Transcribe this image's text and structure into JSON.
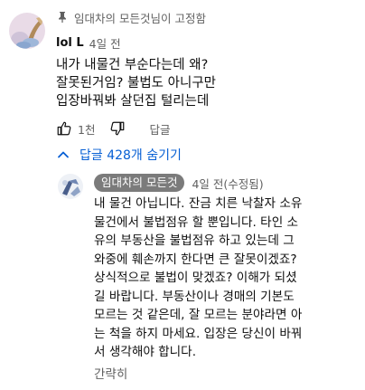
{
  "pinned": {
    "icon": "pin-icon",
    "text": "임대차의 모든것님이 고정함"
  },
  "comment": {
    "author": "lol L",
    "time": "4일 전",
    "lines": [
      "내가 내물건 부순다는데 왜?",
      "잘못된거임? 불법도 아니구만",
      "입장바꿔봐 살던집 털리는데"
    ],
    "likes": "1천",
    "reply_label": "답글"
  },
  "replies_toggle": {
    "label": "답글 428개 숨기기",
    "color": "#065fd4"
  },
  "reply": {
    "author": "임대차의 모든것",
    "time": "4일 전(수정됨)",
    "lines": [
      "내 물건 아닙니다. 잔금 치른 낙찰자 소유",
      "물건에서 불법점유 할 뿐입니다. 타인 소",
      "유의 부동산을 불법점유 하고 있는데 그",
      "와중에 훼손까지 한다면 큰 잘못이겠죠?",
      "상식적으로 불법이 맞겠죠? 이해가 되셨",
      "길 바랍니다.  부동산이나 경매의 기본도",
      "모르는 것 같은데, 잘 모르는 분야라면 아",
      "는 척을 하지 마세요. 입장은 당신이 바꿔",
      "서 생각해야 합니다."
    ],
    "collapse_label": "간략히"
  }
}
